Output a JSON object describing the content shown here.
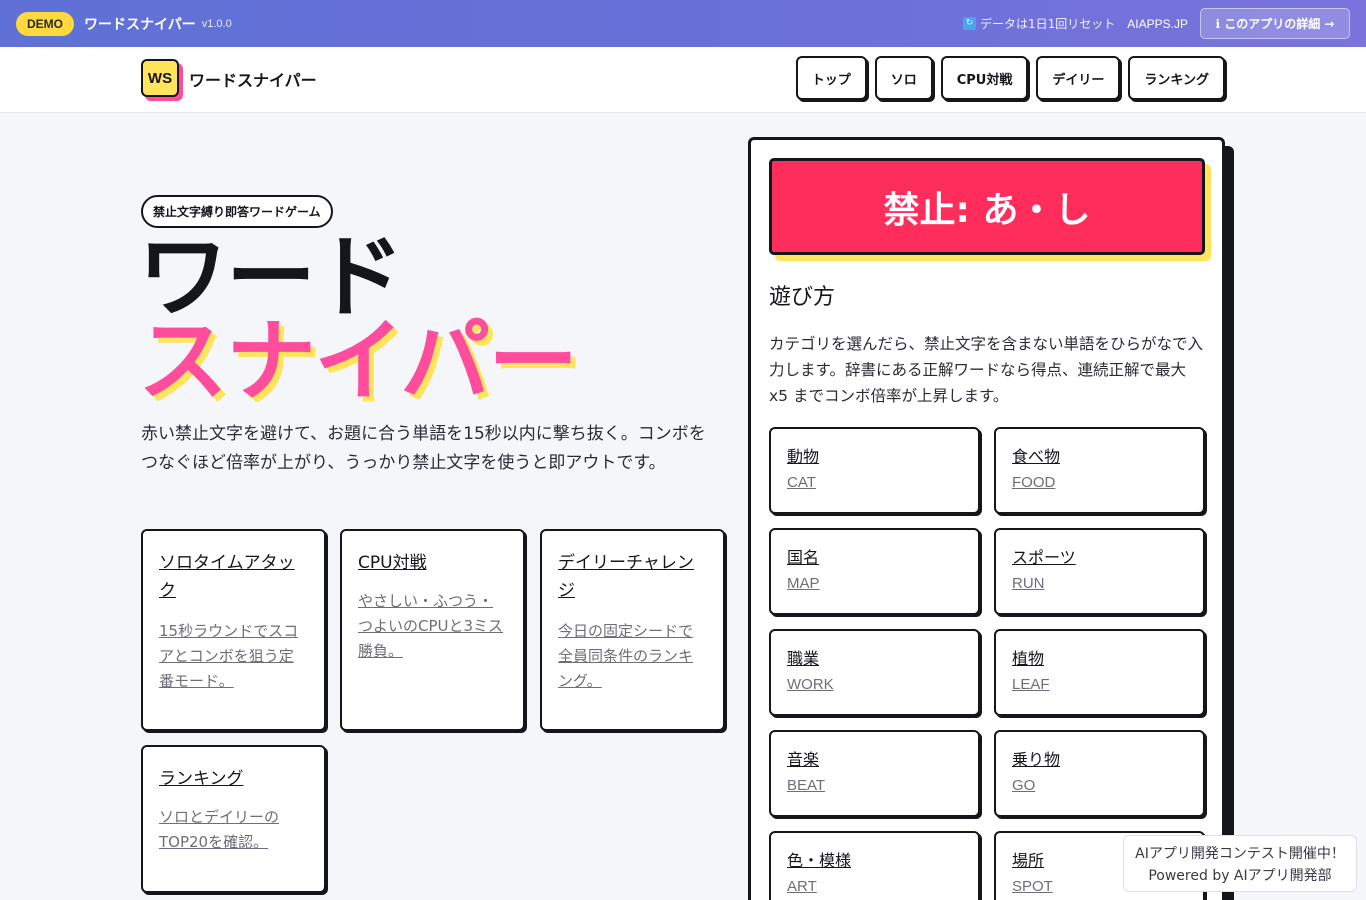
{
  "demo_bar": {
    "badge": "DEMO",
    "title": "ワードスナイパー",
    "version": "v1.0.0",
    "reset_note": "データは1日1回リセット",
    "site_link": "AIAPPS.JP",
    "details_button": "ℹ このアプリの詳細 →"
  },
  "header": {
    "logo": "WS",
    "title": "ワードスナイパー",
    "nav": [
      "トップ",
      "ソロ",
      "CPU対戦",
      "デイリー",
      "ランキング"
    ]
  },
  "hero": {
    "tag": "禁止文字縛り即答ワードゲーム",
    "line1": "ワード",
    "line2": "スナイパー",
    "description": "赤い禁止文字を避けて、お題に合う単語を15秒以内に撃ち抜く。コンボをつなぐほど倍率が上がり、うっかり禁止文字を使うと即アウトです。"
  },
  "modes": [
    {
      "title": "ソロタイムアタック",
      "desc": "15秒ラウンドでスコアとコンボを狙う定番モード。"
    },
    {
      "title": "CPU対戦",
      "desc": "やさしい・ふつう・つよいのCPUと3ミス勝負。"
    },
    {
      "title": "デイリーチャレンジ",
      "desc": "今日の固定シードで全員同条件のランキング。"
    },
    {
      "title": "ランキング",
      "desc": "ソロとデイリーのTOP20を確認。"
    }
  ],
  "panel": {
    "ban_text": "禁止: あ・し",
    "howto_title": "遊び方",
    "howto_text": "カテゴリを選んだら、禁止文字を含まない単語をひらがなで入力します。辞書にある正解ワードなら得点、連続正解で最大 x5 までコンボ倍率が上昇します。",
    "categories": [
      {
        "name": "動物",
        "code": "CAT"
      },
      {
        "name": "食べ物",
        "code": "FOOD"
      },
      {
        "name": "国名",
        "code": "MAP"
      },
      {
        "name": "スポーツ",
        "code": "RUN"
      },
      {
        "name": "職業",
        "code": "WORK"
      },
      {
        "name": "植物",
        "code": "LEAF"
      },
      {
        "name": "音楽",
        "code": "BEAT"
      },
      {
        "name": "乗り物",
        "code": "GO"
      },
      {
        "name": "色・模様",
        "code": "ART"
      },
      {
        "name": "場所",
        "code": "SPOT"
      }
    ]
  },
  "contest": {
    "line1": "AIアプリ開発コンテスト開催中！",
    "line2": "Powered by AIアプリ開発部"
  },
  "colors": {
    "accent_pink": "#ff4d9d",
    "ban_red": "#ff2d5b",
    "highlight_yellow": "#ffe45c",
    "demo_bar": "#6a70d8"
  }
}
